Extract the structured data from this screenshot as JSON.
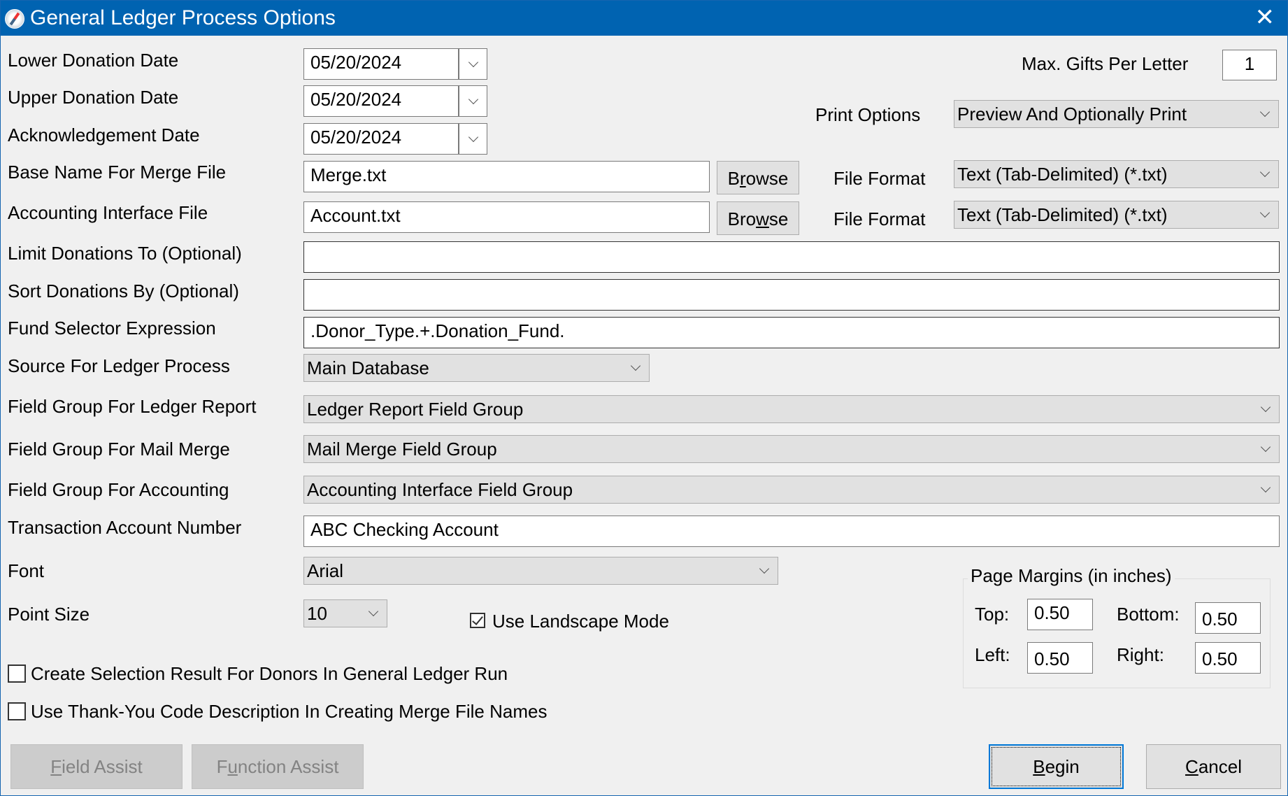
{
  "window": {
    "title": "General Ledger Process Options",
    "icon": "compass-icon",
    "close_icon": "close-icon"
  },
  "fields": {
    "lower_donation_date": {
      "label": "Lower Donation Date",
      "value": "05/20/2024"
    },
    "upper_donation_date": {
      "label": "Upper Donation Date",
      "value": "05/20/2024"
    },
    "acknowledgement_date": {
      "label": "Acknowledgement Date",
      "value": "05/20/2024"
    },
    "merge_file": {
      "label": "Base Name For Merge File",
      "value": "Merge.txt",
      "browse_pre": "B",
      "browse_key": "r",
      "browse_post": "owse"
    },
    "accounting_file": {
      "label": "Accounting Interface File",
      "value": "Account.txt",
      "browse_pre": "Bro",
      "browse_key": "w",
      "browse_post": "se"
    },
    "limit_donations": {
      "label": "Limit Donations To (Optional)",
      "value": ""
    },
    "sort_donations": {
      "label": "Sort Donations By (Optional)",
      "value": ""
    },
    "fund_selector": {
      "label": "Fund Selector Expression",
      "value": ".Donor_Type.+.Donation_Fund."
    },
    "source": {
      "label": "Source For Ledger Process",
      "value": "Main Database"
    },
    "field_group_ledger": {
      "label": "Field Group For Ledger Report",
      "value": "Ledger Report Field Group"
    },
    "field_group_mail": {
      "label": "Field Group For Mail Merge",
      "value": "Mail Merge Field Group"
    },
    "field_group_accounting": {
      "label": "Field Group For Accounting",
      "value": "Accounting Interface Field Group"
    },
    "transaction_account": {
      "label": "Transaction Account Number",
      "value": "ABC Checking Account"
    },
    "font": {
      "label": "Font",
      "value": "Arial"
    },
    "point_size": {
      "label": "Point Size",
      "value": "10"
    }
  },
  "right": {
    "max_gifts": {
      "label": "Max. Gifts Per Letter",
      "value": "1"
    },
    "print_options": {
      "label": "Print Options",
      "value": "Preview And Optionally Print"
    },
    "merge_file_format": {
      "label": "File Format",
      "value": "Text (Tab-Delimited) (*.txt)"
    },
    "accounting_file_format": {
      "label": "File Format",
      "value": "Text (Tab-Delimited) (*.txt)"
    }
  },
  "landscape": {
    "label": "Use Landscape Mode",
    "checked": true
  },
  "margins": {
    "title": "Page Margins (in inches)",
    "top": {
      "label": "Top:",
      "value": "0.50"
    },
    "bottom": {
      "label": "Bottom:",
      "value": "0.50"
    },
    "left": {
      "label": "Left:",
      "value": "0.50"
    },
    "right": {
      "label": "Right:",
      "value": "0.50"
    }
  },
  "checkboxes": {
    "create_selection": {
      "label": "Create Selection Result For Donors In General Ledger Run",
      "checked": false
    },
    "thank_you_code": {
      "label": "Use Thank-You Code Description In Creating Merge File Names",
      "checked": false
    }
  },
  "buttons": {
    "field_assist": {
      "key": "F",
      "rest": "ield Assist",
      "enabled": false
    },
    "function_assist": {
      "pre": "F",
      "key": "u",
      "rest": "nction Assist",
      "enabled": false
    },
    "begin": {
      "key": "B",
      "rest": "egin"
    },
    "cancel": {
      "key": "C",
      "rest": "ancel"
    }
  }
}
